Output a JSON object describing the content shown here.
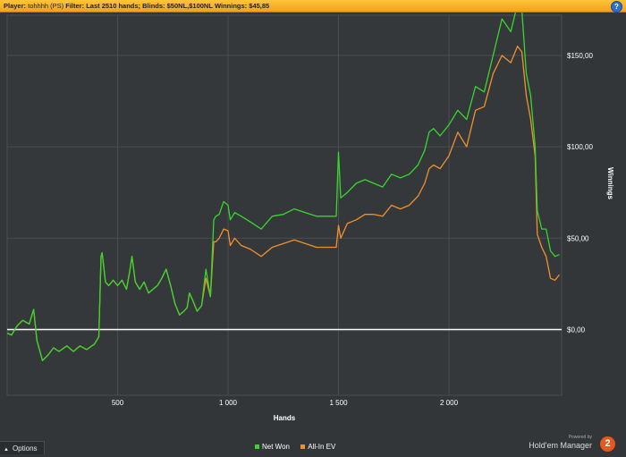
{
  "topbar": {
    "player_label": "Player:",
    "player_value": "tohhhh (PS)",
    "filter_label": "Filter:",
    "filter_value": "Last 2510 hands; Blinds: $50NL,$100NL",
    "winnings_label": "Winnings:",
    "winnings_value": "$45,85",
    "help_glyph": "?"
  },
  "legend": {
    "net_won": "Net Won",
    "allin_ev": "All-In EV"
  },
  "colors": {
    "net_won": "#37d62d",
    "allin_ev": "#f0902c",
    "zero_line": "#ffffff",
    "grid": "#4a4d50"
  },
  "options_label": "Options",
  "brand": {
    "powered": "Powered by",
    "name": "Hold'em Manager",
    "badge": "2"
  },
  "chart_data": {
    "type": "line",
    "xlabel": "Hands",
    "ylabel": "Winnings",
    "xlim": [
      0,
      2510
    ],
    "ylim": [
      -36,
      172
    ],
    "x_ticks": [
      500,
      1000,
      1500,
      2000
    ],
    "x_tick_labels": [
      "500",
      "1 000",
      "1 500",
      "2 000"
    ],
    "y_ticks": [
      0,
      50,
      100,
      150
    ],
    "y_tick_labels": [
      "$0,00",
      "$50,00",
      "$100,00",
      "$150,00"
    ],
    "grid": true,
    "legend_position": "bottom-center",
    "series": [
      {
        "name": "Net Won",
        "x": [
          0,
          20,
          45,
          70,
          100,
          120,
          135,
          160,
          185,
          210,
          235,
          270,
          300,
          330,
          360,
          395,
          415,
          425,
          430,
          445,
          460,
          480,
          500,
          520,
          540,
          555,
          565,
          580,
          600,
          620,
          640,
          660,
          680,
          700,
          720,
          740,
          760,
          780,
          800,
          815,
          825,
          840,
          860,
          880,
          900,
          920,
          935,
          945,
          960,
          980,
          1000,
          1010,
          1030,
          1060,
          1100,
          1150,
          1200,
          1250,
          1300,
          1350,
          1400,
          1440,
          1470,
          1490,
          1500,
          1510,
          1540,
          1580,
          1620,
          1660,
          1700,
          1740,
          1780,
          1820,
          1860,
          1890,
          1910,
          1930,
          1960,
          2000,
          2040,
          2080,
          2120,
          2160,
          2200,
          2240,
          2280,
          2310,
          2330,
          2350,
          2370,
          2390,
          2400,
          2420,
          2440,
          2460,
          2480,
          2500
        ],
        "y": [
          -2,
          -3,
          2,
          5,
          3,
          11,
          -6,
          -17,
          -14,
          -10,
          -12,
          -9,
          -12,
          -9,
          -11,
          -8,
          -4,
          40,
          42,
          26,
          24,
          27,
          24,
          27,
          22,
          32,
          40,
          26,
          22,
          26,
          20,
          22,
          24,
          28,
          33,
          24,
          14,
          8,
          10,
          12,
          20,
          16,
          10,
          13,
          33,
          18,
          60,
          62,
          63,
          70,
          68,
          60,
          64,
          62,
          59,
          55,
          62,
          63,
          66,
          64,
          62,
          62,
          62,
          62,
          97,
          72,
          75,
          80,
          82,
          80,
          78,
          85,
          83,
          85,
          90,
          98,
          108,
          110,
          106,
          112,
          120,
          115,
          133,
          130,
          150,
          170,
          163,
          178,
          175,
          140,
          128,
          100,
          65,
          55,
          55,
          43,
          40,
          41
        ]
      },
      {
        "name": "All-In EV",
        "x": [
          0,
          20,
          45,
          70,
          100,
          120,
          135,
          160,
          185,
          210,
          235,
          270,
          300,
          330,
          360,
          395,
          415,
          425,
          430,
          445,
          460,
          480,
          500,
          520,
          540,
          555,
          565,
          580,
          600,
          620,
          640,
          660,
          680,
          700,
          720,
          740,
          760,
          780,
          800,
          815,
          825,
          840,
          860,
          880,
          900,
          920,
          935,
          945,
          960,
          980,
          1000,
          1010,
          1030,
          1060,
          1100,
          1150,
          1200,
          1250,
          1300,
          1350,
          1400,
          1440,
          1470,
          1490,
          1500,
          1510,
          1540,
          1580,
          1620,
          1660,
          1700,
          1740,
          1780,
          1820,
          1860,
          1890,
          1910,
          1930,
          1960,
          2000,
          2040,
          2080,
          2120,
          2160,
          2200,
          2240,
          2280,
          2310,
          2330,
          2350,
          2370,
          2390,
          2400,
          2420,
          2440,
          2460,
          2480,
          2500
        ],
        "y": [
          -2,
          -3,
          2,
          5,
          3,
          11,
          -6,
          -17,
          -14,
          -10,
          -12,
          -9,
          -12,
          -9,
          -11,
          -8,
          -4,
          40,
          42,
          26,
          24,
          27,
          24,
          27,
          22,
          32,
          40,
          26,
          22,
          26,
          20,
          22,
          24,
          28,
          33,
          24,
          14,
          8,
          10,
          12,
          20,
          16,
          10,
          13,
          28,
          18,
          48,
          48,
          50,
          55,
          54,
          46,
          50,
          46,
          44,
          40,
          45,
          47,
          49,
          47,
          45,
          45,
          45,
          45,
          57,
          50,
          58,
          60,
          63,
          63,
          62,
          68,
          66,
          68,
          73,
          80,
          88,
          90,
          88,
          95,
          108,
          100,
          120,
          122,
          140,
          150,
          146,
          155,
          152,
          128,
          115,
          95,
          52,
          45,
          40,
          28,
          27,
          30
        ]
      }
    ]
  }
}
